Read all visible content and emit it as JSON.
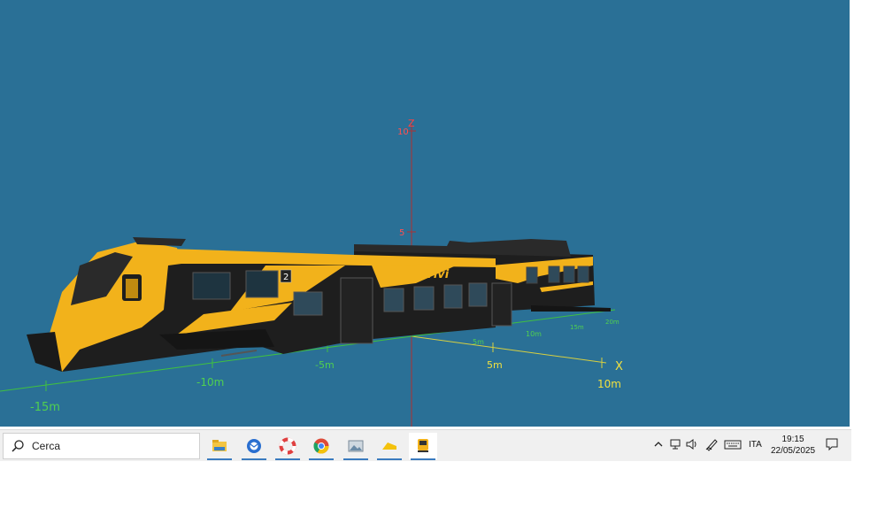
{
  "viewport": {
    "background": "#2a7096",
    "axes": {
      "z_label": "Z",
      "z_ticks": [
        "10",
        "5"
      ],
      "x_label": "X",
      "x_ticks": [
        "5m",
        "10m",
        "-5m",
        "-10m",
        "-15m"
      ],
      "y_ticks": [
        "5m",
        "10m",
        "15m",
        "20m"
      ]
    },
    "train": {
      "logo": "Vivi",
      "class_label": "2",
      "body_color": "#f2b21b",
      "stripe_color": "#1e1e1e"
    }
  },
  "taskbar": {
    "search_placeholder": "Cerca",
    "apps": [
      {
        "name": "file-explorer-icon"
      },
      {
        "name": "thunderbird-icon"
      },
      {
        "name": "lifesaver-app-icon"
      },
      {
        "name": "chrome-icon"
      },
      {
        "name": "image-viewer-icon"
      },
      {
        "name": "cheese-app-icon"
      },
      {
        "name": "train-simulator-icon"
      }
    ],
    "language": "ITA",
    "time": "19:15",
    "date": "22/05/2025"
  }
}
